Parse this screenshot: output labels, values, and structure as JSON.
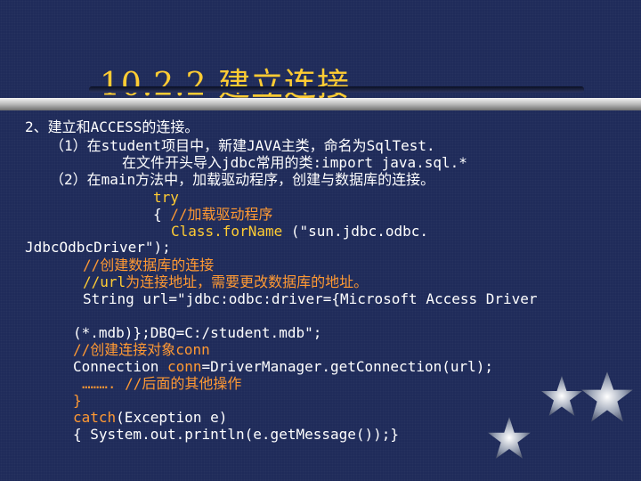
{
  "title": "10.2.2 建立连接",
  "lines": {
    "l1": "2、建立和ACCESS的连接。",
    "l2": "（1）在student项目中，新建JAVA主类，命名为SqlTest.",
    "l3": "在文件开头导入jdbc常用的类:import java.sql.*",
    "l4": "（2）在main方法中，加载驱动程序，创建与数据库的连接。",
    "l5": "try",
    "l6a": "{   ",
    "l6b": "//加载驱动程序",
    "l7a": "Class.forName",
    "l7b": " (\"sun.jdbc.odbc.",
    "l8": "JdbcOdbcDriver\");",
    "l9": "//创建数据库的连接",
    "l10a": "//url",
    "l10b": "为连接地址，需要更改数据库的地址。",
    "l11": "String url=\"jdbc:odbc:driver={Microsoft Access Driver",
    "l12": "(*.mdb)};DBQ=C:/student.mdb\";",
    "l13a": "//创建连接对象",
    "l13b": "conn",
    "l14a": "Connection ",
    "l14b": "conn",
    "l14c": "=DriverManager.getConnection(url);",
    "l15a": "……….",
    "l15b": "  //后面的其他操作",
    "l16": "}",
    "l17a": "catch",
    "l17b": "(Exception  e)",
    "l18": "{ System.out.println(e.getMessage());}"
  },
  "colors": {
    "background": "#1f2b5a",
    "title": "#ffcc33",
    "text": "#ffffff",
    "keyword": "#ffcc33",
    "comment": "#ff9933"
  },
  "icons": [
    "star-icon"
  ]
}
